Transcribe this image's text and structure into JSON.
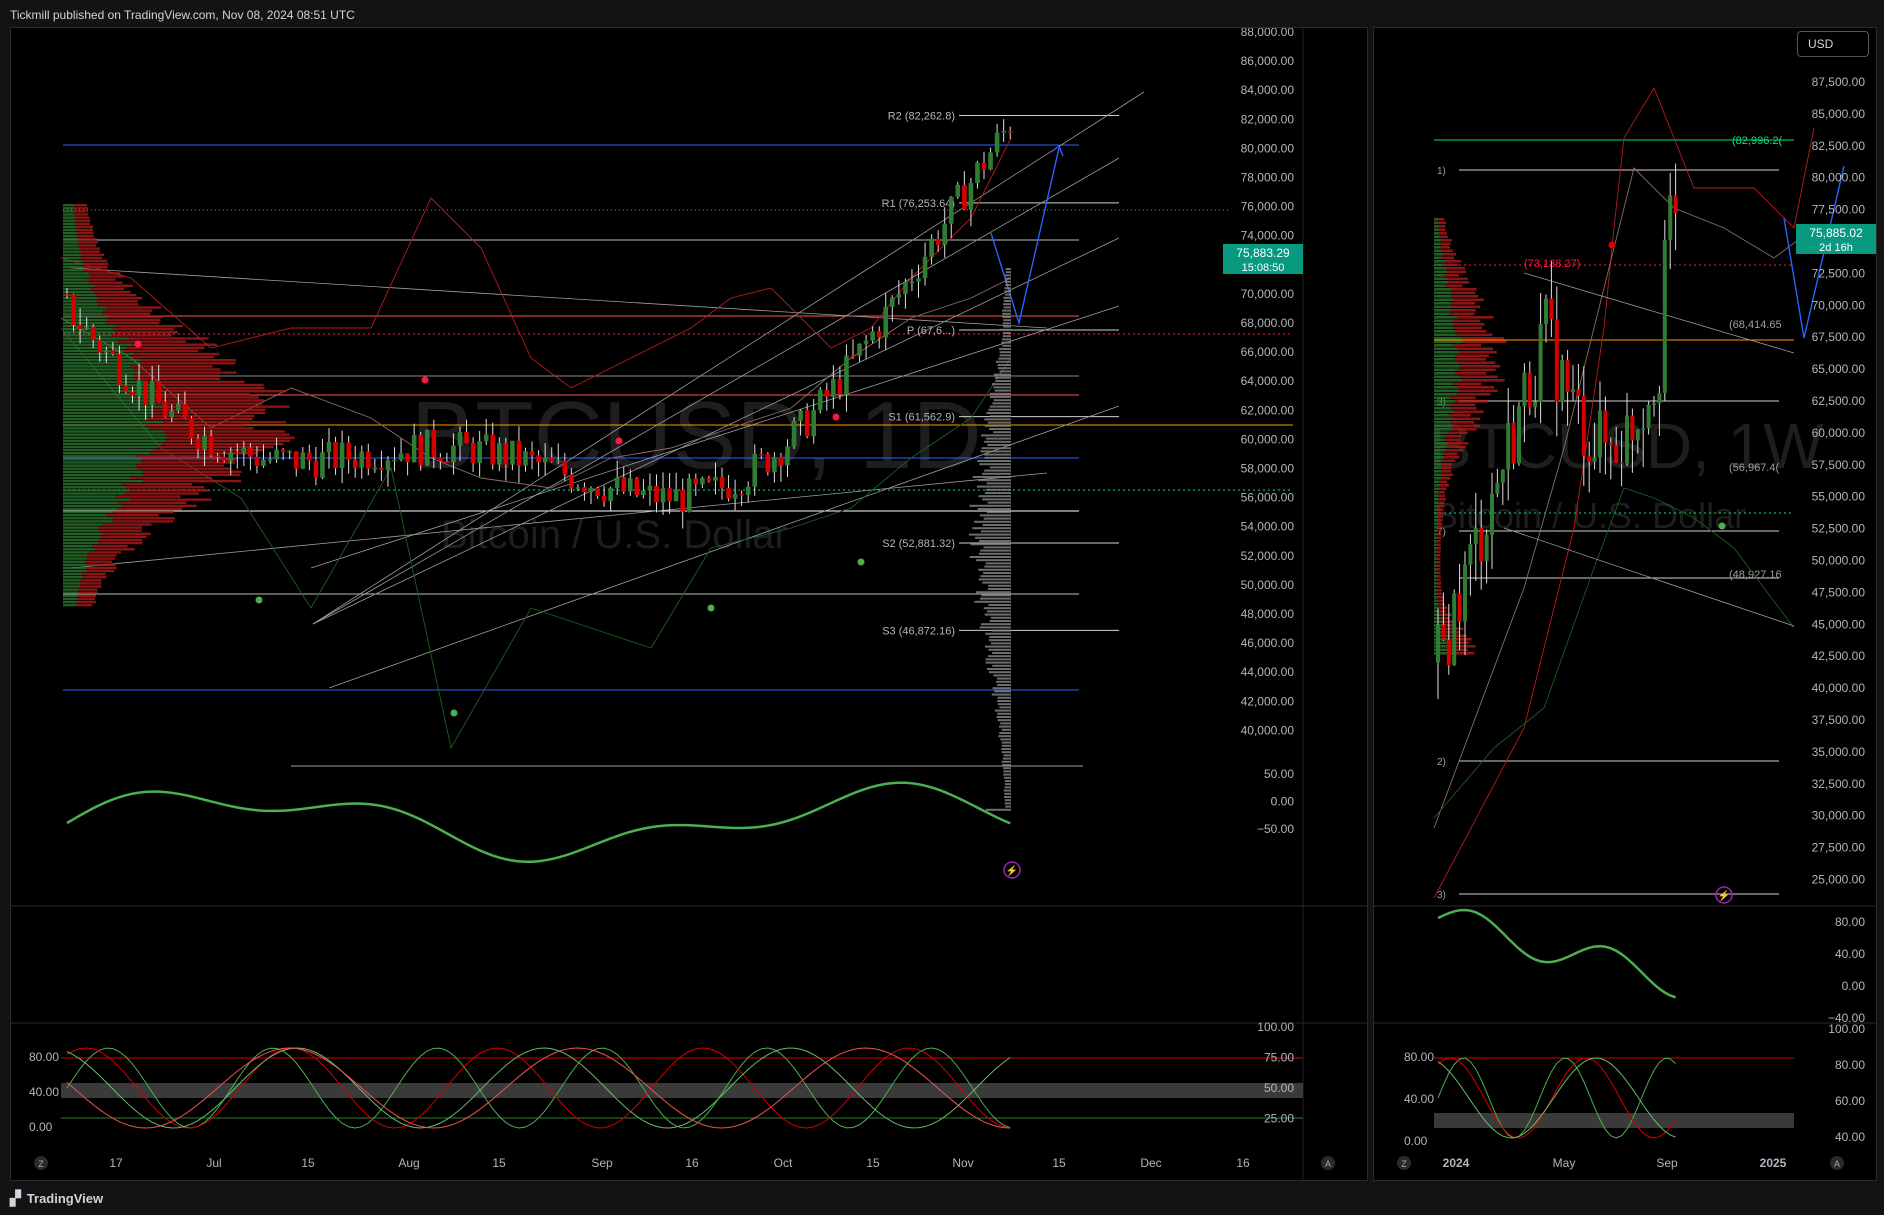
{
  "header": {
    "publish_text": "Tickmill published on TradingView.com, Nov 08, 2024 08:51 UTC"
  },
  "footer": {
    "brand": "TradingView",
    "logo_icon": "tradingview-logo-icon"
  },
  "colors": {
    "up": "#2e7d32",
    "down": "#d50000",
    "pivot": "#cfcfcf",
    "poc": "#ff9800",
    "blue_line": "#2962ff",
    "price_label": "#089981"
  },
  "left_chart": {
    "watermark_symbol": "BTCUSD, 1D",
    "watermark_name": "Bitcoin / U.S. Dollar",
    "price_axis": [
      "88,000.00",
      "86,000.00",
      "84,000.00",
      "82,000.00",
      "80,000.00",
      "78,000.00",
      "76,000.00",
      "74,000.00",
      "72,000.00",
      "70,000.00",
      "68,000.00",
      "66,000.00",
      "64,000.00",
      "62,000.00",
      "60,000.00",
      "58,000.00",
      "56,000.00",
      "54,000.00",
      "52,000.00",
      "50,000.00",
      "48,000.00",
      "46,000.00",
      "44,000.00",
      "42,000.00",
      "40,000.00"
    ],
    "current_price": "75,883.29",
    "countdown": "15:08:50",
    "pivots": [
      {
        "label": "R2 (82,262.8)",
        "value": 82262.8
      },
      {
        "label": "R1 (76,253.64)",
        "value": 76253.64
      },
      {
        "label": "S1 (61,562.9)",
        "value": 61562.9
      },
      {
        "label": "S2 (52,881.32)",
        "value": 52881.32
      },
      {
        "label": "S3 (46,872.16)",
        "value": 46872.16
      }
    ],
    "pivot_p_label": "P (67,6...)",
    "time_axis": [
      "17",
      "Jul",
      "15",
      "Aug",
      "15",
      "Sep",
      "16",
      "Oct",
      "15",
      "Nov",
      "15",
      "Dec",
      "16"
    ],
    "osc1_axis": [
      "50.00",
      "0.00",
      "−50.00"
    ],
    "osc2_axis_left": [
      "80.00",
      "40.00",
      "0.00"
    ],
    "osc2_axis_right": [
      "100.00",
      "75.00",
      "50.00",
      "25.00"
    ],
    "z_button": "Z",
    "a_button": "A"
  },
  "right_chart": {
    "currency_button": "USD",
    "watermark_symbol": "BTCUSD, 1W",
    "watermark_name": "Bitcoin / U.S. Dollar",
    "price_axis": [
      "87,500.00",
      "85,000.00",
      "82,500.00",
      "80,000.00",
      "77,500.00",
      "75,000.00",
      "72,500.00",
      "70,000.00",
      "67,500.00",
      "65,000.00",
      "62,500.00",
      "60,000.00",
      "57,500.00",
      "55,000.00",
      "52,500.00",
      "50,000.00",
      "47,500.00",
      "45,000.00",
      "42,500.00",
      "40,000.00",
      "37,500.00",
      "35,000.00",
      "32,500.00",
      "30,000.00",
      "27,500.00",
      "25,000.00"
    ],
    "current_price": "75,885.02",
    "countdown": "2d 16h",
    "level_labels": [
      "(82,996.2(",
      "(73,138.27)",
      "(68,414.65",
      "(56,967.4(",
      "(48,927.16"
    ],
    "left_stub_labels": [
      "1)",
      "3)",
      "7)",
      "2)",
      "3)"
    ],
    "time_axis": [
      "2024",
      "May",
      "Sep",
      "2025"
    ],
    "osc1_axis": [
      "80.00",
      "40.00",
      "0.00",
      "−40.00"
    ],
    "osc2_axis_left": [
      "80.00",
      "40.00",
      "0.00"
    ],
    "osc2_axis_right": [
      "100.00",
      "80.00",
      "60.00",
      "40.00"
    ],
    "z_button": "Z",
    "a_button": "A"
  }
}
